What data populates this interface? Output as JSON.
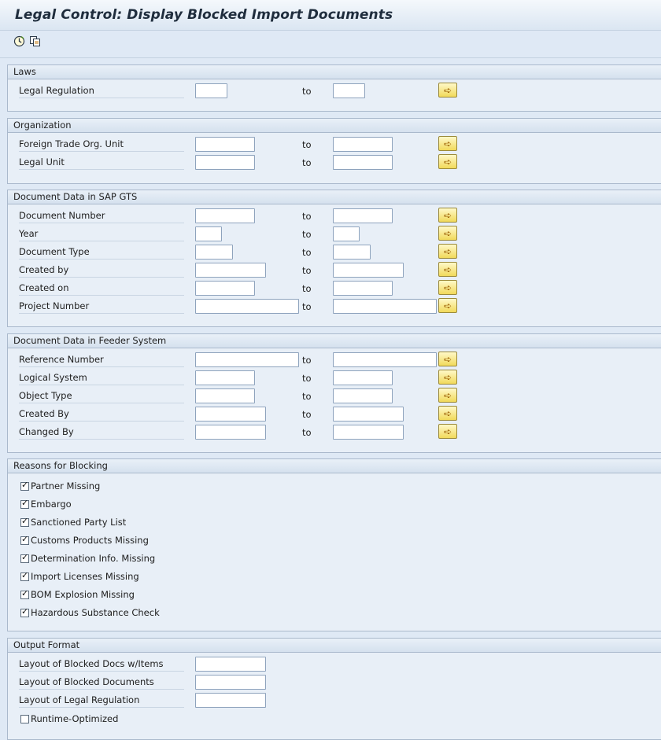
{
  "title": "Legal Control: Display Blocked Import Documents",
  "toolbar": {
    "execute_icon": "execute-clock-icon",
    "variant_icon": "get-variant-icon"
  },
  "range_to_label": "to",
  "groups": {
    "laws": {
      "title": "Laws",
      "fields": [
        "Legal Regulation"
      ]
    },
    "org": {
      "title": "Organization",
      "fields": [
        "Foreign Trade Org. Unit",
        "Legal Unit"
      ]
    },
    "gts": {
      "title": "Document Data in SAP GTS",
      "fields": [
        "Document Number",
        "Year",
        "Document Type",
        "Created by",
        "Created on",
        "Project Number"
      ]
    },
    "feeder": {
      "title": "Document Data in Feeder System",
      "fields": [
        "Reference Number",
        "Logical System",
        "Object Type",
        "Created By",
        "Changed By"
      ]
    },
    "reasons": {
      "title": "Reasons for Blocking",
      "items": [
        {
          "label": "Partner Missing",
          "checked": true
        },
        {
          "label": "Embargo",
          "checked": true
        },
        {
          "label": "Sanctioned Party List",
          "checked": true
        },
        {
          "label": "Customs Products Missing",
          "checked": true
        },
        {
          "label": "Determination Info. Missing",
          "checked": true
        },
        {
          "label": "Import Licenses Missing",
          "checked": true
        },
        {
          "label": "BOM Explosion Missing",
          "checked": true
        },
        {
          "label": "Hazardous Substance Check",
          "checked": true
        }
      ]
    },
    "output": {
      "title": "Output Format",
      "fields": [
        "Layout of Blocked Docs w/Items",
        "Layout of Blocked Documents",
        "Layout of Legal Regulation"
      ],
      "checkbox": {
        "label": "Runtime-Optimized",
        "checked": false
      }
    }
  }
}
